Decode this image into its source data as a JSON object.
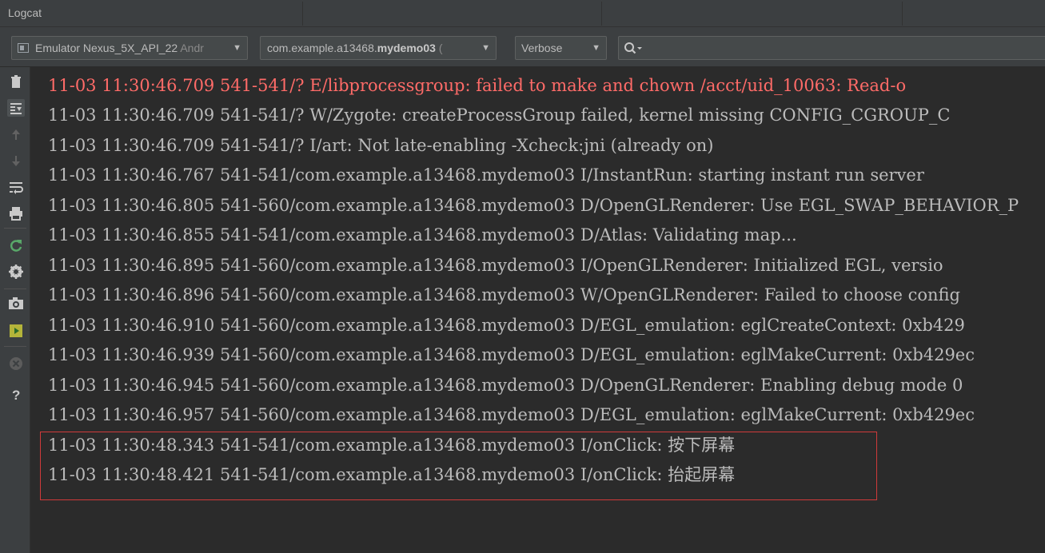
{
  "window": {
    "title": "Logcat"
  },
  "toolbar": {
    "device": {
      "label": "Emulator Nexus_5X_API_22",
      "suffix": "Andr"
    },
    "process": {
      "prefix": "com.example.a13468.",
      "bold": "mydemo03",
      "suffix": "("
    },
    "level": {
      "value": "Verbose"
    },
    "search": {
      "placeholder": ""
    }
  },
  "sidebar": {
    "buttons": [
      {
        "name": "clear-logcat-icon"
      },
      {
        "name": "scroll-to-end-icon",
        "active": true
      },
      {
        "name": "up-arrow-icon"
      },
      {
        "name": "down-arrow-icon"
      },
      {
        "name": "soft-wrap-icon"
      },
      {
        "name": "print-icon"
      },
      {
        "name": "restart-icon"
      },
      {
        "name": "settings-gear-icon"
      },
      {
        "name": "screenshot-camera-icon"
      },
      {
        "name": "screen-record-icon"
      },
      {
        "name": "close-icon"
      },
      {
        "name": "help-icon"
      }
    ]
  },
  "colors": {
    "error": "#ff6b68",
    "text": "#bbbbbb",
    "highlight_border": "#d03a3a",
    "background": "#2b2b2b"
  },
  "log": {
    "lines": [
      {
        "text": "11-03 11:30:46.709 541-541/? E/libprocessgroup: failed to make and chown /acct/uid_10063: Read-o",
        "level": "E"
      },
      {
        "text": "11-03 11:30:46.709 541-541/? W/Zygote: createProcessGroup failed, kernel missing CONFIG_CGROUP_C",
        "level": "W"
      },
      {
        "text": "11-03 11:30:46.709 541-541/? I/art: Not late-enabling -Xcheck:jni (already on)",
        "level": "I"
      },
      {
        "text": "11-03 11:30:46.767 541-541/com.example.a13468.mydemo03 I/InstantRun: starting instant run server",
        "level": "I"
      },
      {
        "text": "11-03 11:30:46.805 541-560/com.example.a13468.mydemo03 D/OpenGLRenderer: Use EGL_SWAP_BEHAVIOR_P",
        "level": "D"
      },
      {
        "text": "11-03 11:30:46.855 541-541/com.example.a13468.mydemo03 D/Atlas: Validating map...",
        "level": "D"
      },
      {
        "text": "11-03 11:30:46.895 541-560/com.example.a13468.mydemo03 I/OpenGLRenderer: Initialized EGL, versio",
        "level": "I"
      },
      {
        "text": "11-03 11:30:46.896 541-560/com.example.a13468.mydemo03 W/OpenGLRenderer: Failed to choose config",
        "level": "W"
      },
      {
        "text": "11-03 11:30:46.910 541-560/com.example.a13468.mydemo03 D/EGL_emulation: eglCreateContext: 0xb429",
        "level": "D"
      },
      {
        "text": "11-03 11:30:46.939 541-560/com.example.a13468.mydemo03 D/EGL_emulation: eglMakeCurrent: 0xb429ec",
        "level": "D"
      },
      {
        "text": "11-03 11:30:46.945 541-560/com.example.a13468.mydemo03 D/OpenGLRenderer: Enabling debug mode 0",
        "level": "D"
      },
      {
        "text": "11-03 11:30:46.957 541-560/com.example.a13468.mydemo03 D/EGL_emulation: eglMakeCurrent: 0xb429ec",
        "level": "D"
      },
      {
        "text": "11-03 11:30:48.343 541-541/com.example.a13468.mydemo03 I/onClick: 按下屏幕",
        "level": "I"
      },
      {
        "text": "11-03 11:30:48.421 541-541/com.example.a13468.mydemo03 I/onClick: 抬起屏幕",
        "level": "I"
      }
    ]
  }
}
